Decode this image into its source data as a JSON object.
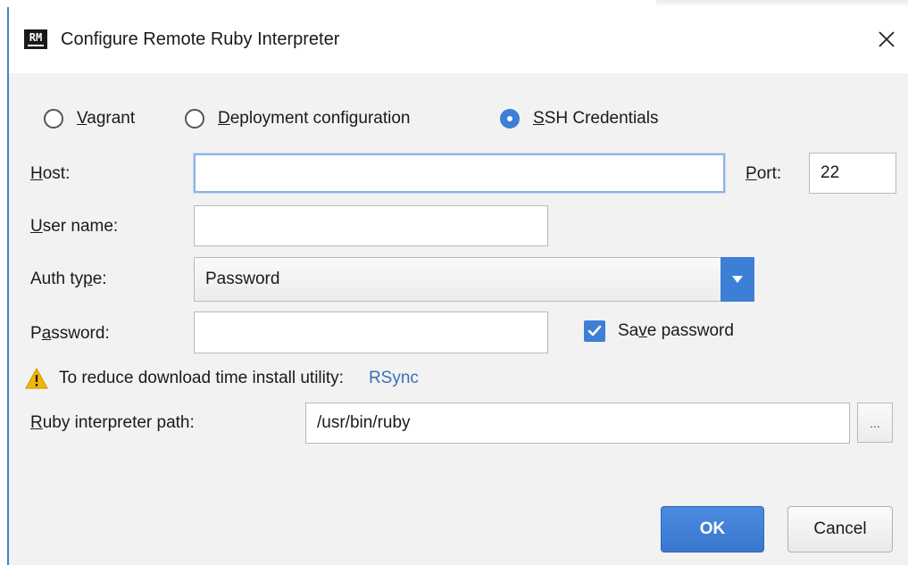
{
  "window": {
    "app_logo_text": "RM",
    "title": "Configure Remote Ruby Interpreter"
  },
  "connection_type": {
    "options": [
      {
        "label": "Vagrant",
        "mnemonic": "V",
        "rest": "agrant",
        "selected": false
      },
      {
        "label": "Deployment configuration",
        "mnemonic": "D",
        "rest": "eployment configuration",
        "selected": false
      },
      {
        "label": "SSH Credentials",
        "mnemonic": "S",
        "rest": "SH Credentials",
        "selected": true
      }
    ]
  },
  "form": {
    "host": {
      "label_pre": "",
      "label_mn": "H",
      "label_post": "ost:",
      "value": ""
    },
    "port": {
      "label_pre": "",
      "label_mn": "P",
      "label_post": "ort:",
      "value": "22"
    },
    "user_name": {
      "label_pre": "",
      "label_mn": "U",
      "label_post": "ser name:",
      "value": ""
    },
    "auth_type": {
      "label_pre": "Auth ty",
      "label_mn": "p",
      "label_post": "e:",
      "selected": "Password"
    },
    "password": {
      "label_pre": "P",
      "label_mn": "a",
      "label_post": "ssword:",
      "value": ""
    },
    "save_password": {
      "label_pre": "Sa",
      "label_mn": "v",
      "label_post": "e password",
      "checked": true
    },
    "warning": {
      "text": "To reduce download time install utility:",
      "link": "RSync"
    },
    "ruby_path": {
      "label_pre": "",
      "label_mn": "R",
      "label_post": "uby interpreter path:",
      "value": "/usr/bin/ruby",
      "browse_label": "..."
    }
  },
  "buttons": {
    "ok": "OK",
    "cancel": "Cancel"
  },
  "colors": {
    "accent": "#3e7fd6",
    "link": "#3870b8",
    "warning": "#f2b705",
    "dialog_bg": "#f2f2f2"
  }
}
